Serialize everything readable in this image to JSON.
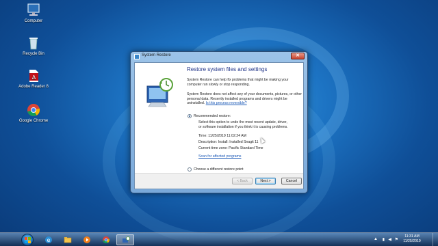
{
  "desktop": {
    "icons": [
      {
        "label": "Computer",
        "icon": "computer-icon"
      },
      {
        "label": "Recycle Bin",
        "icon": "recycle-bin-icon"
      },
      {
        "label": "Adobe Reader 8",
        "icon": "adobe-reader-icon"
      },
      {
        "label": "Google Chrome",
        "icon": "chrome-icon"
      }
    ]
  },
  "window": {
    "title": "System Restore",
    "close_label": "✕",
    "heading": "Restore system files and settings",
    "intro": "System Restore can help fix problems that might be making your computer run slowly or stop responding.",
    "detail": "System Restore does not affect any of your documents, pictures, or other personal data. Recently installed programs and drivers might be uninstalled.",
    "detail_link": "Is this process reversible?",
    "recommended_label": "Recommended restore:",
    "recommended_desc": "Select this option to undo the most recent update, driver, or software installation if you think it is causing problems.",
    "time": "Time: 11/25/2019 11:02:24 AM",
    "description": "Description: Install: Installed Snagit 11",
    "timezone": "Current time zone: Pacific Standard Time",
    "scan_link": "Scan for affected programs",
    "different_label": "Choose a different restore point",
    "buttons": {
      "back": "< Back",
      "next": "Next >",
      "cancel": "Cancel"
    },
    "selected_option": "recommended"
  },
  "taskbar": {
    "items": [
      {
        "icon": "internet-explorer-icon"
      },
      {
        "icon": "file-explorer-icon"
      },
      {
        "icon": "media-player-icon"
      },
      {
        "icon": "chrome-icon"
      },
      {
        "icon": "system-restore-icon",
        "active": true
      }
    ],
    "clock": {
      "time": "11:31 AM",
      "date": "11/25/2019"
    }
  },
  "colors": {
    "accent": "#1e3287",
    "link": "#1a58b6",
    "desktop": "#1d74c4"
  }
}
